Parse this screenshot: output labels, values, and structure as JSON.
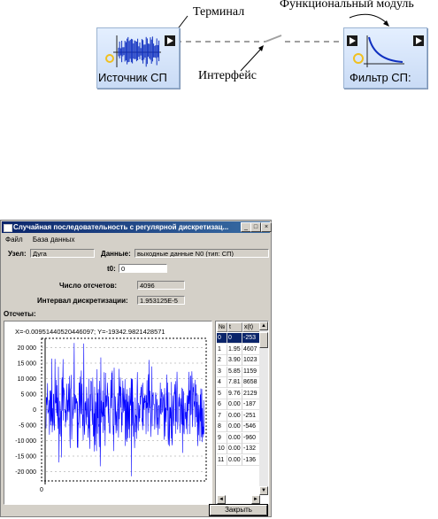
{
  "diagram": {
    "annotations": {
      "terminal": "Терминал",
      "functional_module": "Функциональный модуль",
      "interface": "Интерфейс"
    },
    "blocks": [
      {
        "label": "Источник СП",
        "icon": "noise-signal-icon"
      },
      {
        "label": "Фильтр СП:",
        "icon": "decay-curve-icon"
      }
    ],
    "colors": {
      "block_fill": "#d6e4fa",
      "connector": "#a0a0a0",
      "icon_blue": "#1030c0",
      "port": "#1a1a1a",
      "gear": "#f0c020"
    }
  },
  "window": {
    "title": "Случайная последовательность с регулярной дискретизац...",
    "buttons": [
      "_",
      "□",
      "×"
    ],
    "menu": [
      "Файл",
      "База данных"
    ],
    "node_label": "Узел:",
    "node_value": "Дуга",
    "data_label": "Данные:",
    "data_value": "выходные данные N0 (тип: СП)",
    "t0_label": "t0:",
    "t0_value": "0",
    "count_label": "Число отсчетов:",
    "count_value": "4096",
    "interval_label": "Интервал дискретизации:",
    "interval_value": "1.953125E-5",
    "samples_label": "Отсчеты:",
    "close_label": "Закрыть"
  },
  "chart_data": {
    "type": "line",
    "readout": "X=-0.00951440520446097; Y=-19342.9821428571",
    "y_ticks": [
      "20 000",
      "15 000",
      "10 000",
      "5 000",
      "0",
      "-5 000",
      "-10 000",
      "-15 000",
      "-20 000"
    ],
    "x_ticks": [
      "0"
    ],
    "ylim": [
      -23000,
      23000
    ],
    "series": [
      {
        "color": "#0000ff",
        "character": "dense random noise, amplitude mostly within ±15000, peaks ±20000"
      }
    ]
  },
  "table": {
    "columns": [
      "№",
      "t",
      "x(t)"
    ],
    "rows": [
      [
        "0",
        "0",
        "-253"
      ],
      [
        "1",
        "1.95",
        "4607"
      ],
      [
        "2",
        "3.90",
        "1023"
      ],
      [
        "3",
        "5.85",
        "1159"
      ],
      [
        "4",
        "7.81",
        "8658"
      ],
      [
        "5",
        "9.76",
        "2129"
      ],
      [
        "6",
        "0.00",
        "-187"
      ],
      [
        "7",
        "0.00",
        "-251"
      ],
      [
        "8",
        "0.00",
        "-546"
      ],
      [
        "9",
        "0.00",
        "-960"
      ],
      [
        "10",
        "0.00",
        "-132"
      ],
      [
        "11",
        "0.00",
        "-136"
      ]
    ]
  }
}
